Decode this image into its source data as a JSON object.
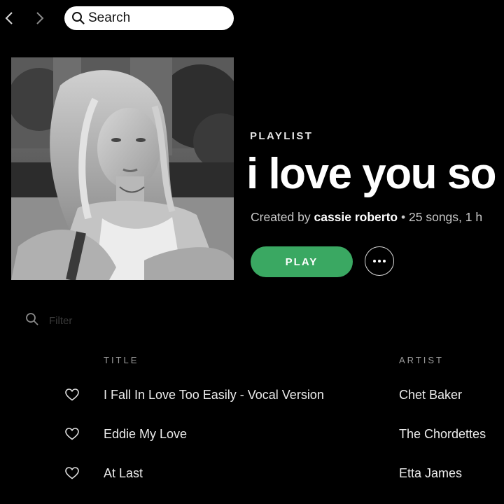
{
  "nav": {
    "back_icon": "chevron-left-icon",
    "forward_icon": "chevron-right-icon"
  },
  "search": {
    "placeholder": "Search",
    "icon": "search-icon"
  },
  "playlist": {
    "type_label": "PLAYLIST",
    "title": "i love you so",
    "created_by_prefix": "Created by",
    "owner": "cassie roberto",
    "separator": "•",
    "stats": "25 songs, 1 h",
    "cover_alt_icon": "playlist-cover-photo"
  },
  "actions": {
    "play_label": "PLAY",
    "more_icon": "more-options-icon",
    "play_color": "#3aa862"
  },
  "filter": {
    "placeholder": "Filter",
    "icon": "search-icon"
  },
  "columns": {
    "title": "TITLE",
    "artist": "ARTIST"
  },
  "tracks": [
    {
      "title": "I Fall In Love Too Easily - Vocal Version",
      "artist": "Chet Baker"
    },
    {
      "title": "Eddie My Love",
      "artist": "The Chordettes"
    },
    {
      "title": "At Last",
      "artist": "Etta James"
    }
  ]
}
